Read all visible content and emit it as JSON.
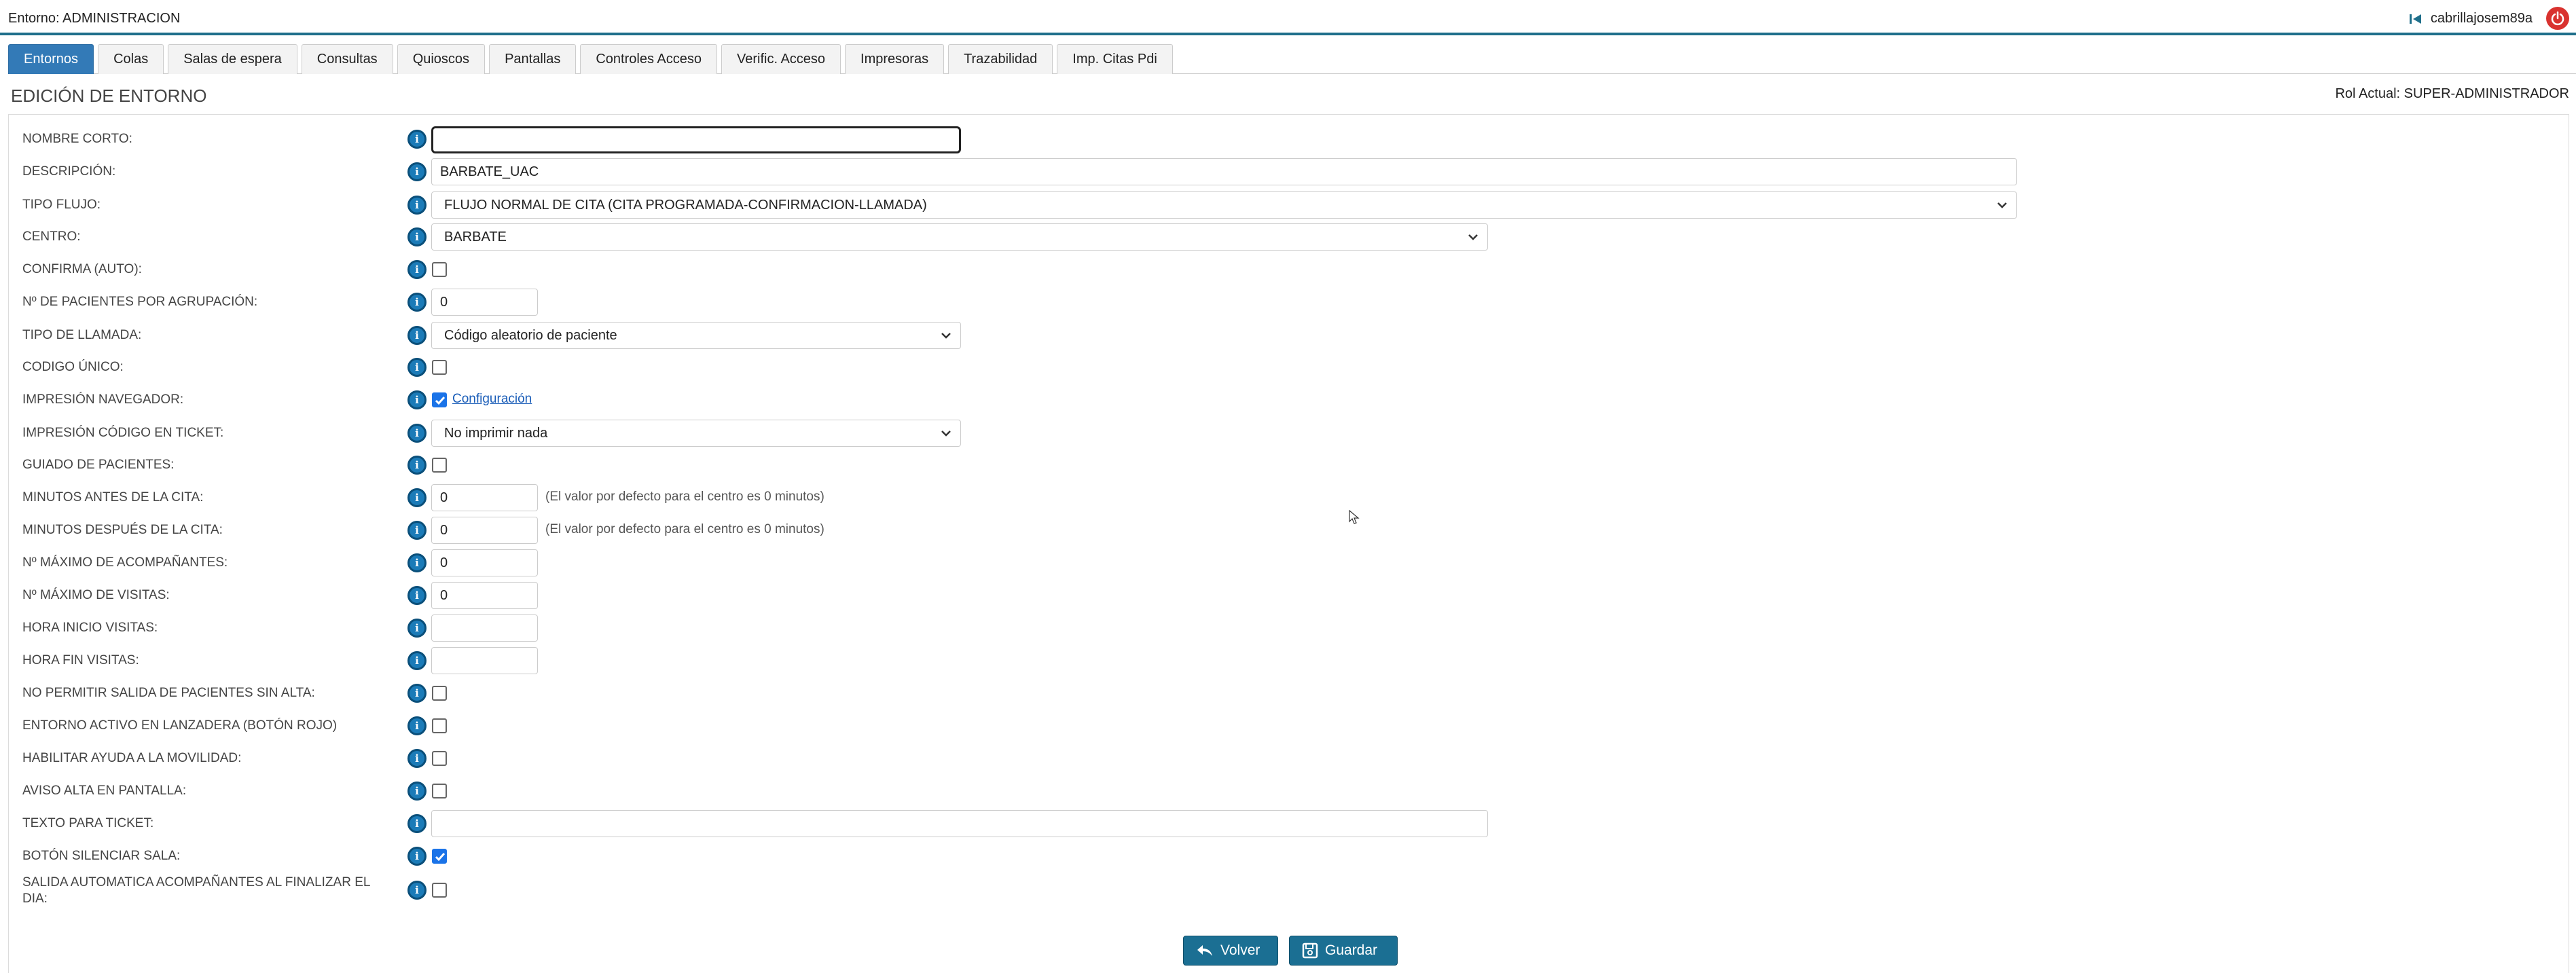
{
  "topbar": {
    "environment": "Entorno: ADMINISTRACION",
    "username": "cabrillajosem89a"
  },
  "tabs": [
    {
      "label": "Entornos",
      "active": true
    },
    {
      "label": "Colas",
      "active": false
    },
    {
      "label": "Salas de espera",
      "active": false
    },
    {
      "label": "Consultas",
      "active": false
    },
    {
      "label": "Quioscos",
      "active": false
    },
    {
      "label": "Pantallas",
      "active": false
    },
    {
      "label": "Controles Acceso",
      "active": false
    },
    {
      "label": "Verific. Acceso",
      "active": false
    },
    {
      "label": "Impresoras",
      "active": false
    },
    {
      "label": "Trazabilidad",
      "active": false
    },
    {
      "label": "Imp. Citas Pdi",
      "active": false
    }
  ],
  "section_title": "EDICIÓN DE ENTORNO",
  "role": "Rol Actual: SUPER-ADMINISTRADOR",
  "fields": {
    "nombre_corto": {
      "label": "NOMBRE CORTO:",
      "value": ""
    },
    "descripcion": {
      "label": "DESCRIPCIÓN:",
      "value": "BARBATE_UAC"
    },
    "tipo_flujo": {
      "label": "TIPO FLUJO:",
      "value": "FLUJO NORMAL DE CITA (CITA PROGRAMADA-CONFIRMACION-LLAMADA)"
    },
    "centro": {
      "label": "CENTRO:",
      "value": "BARBATE"
    },
    "confirma_auto": {
      "label": "CONFIRMA (AUTO):",
      "checked": false
    },
    "pacientes_agrupacion": {
      "label": "Nº DE PACIENTES POR AGRUPACIÓN:",
      "value": "0"
    },
    "tipo_llamada": {
      "label": "TIPO DE LLAMADA:",
      "value": "Código aleatorio de paciente"
    },
    "codigo_unico": {
      "label": "CODIGO ÚNICO:",
      "checked": false
    },
    "impresion_navegador": {
      "label": "IMPRESIÓN NAVEGADOR:",
      "checked": true,
      "link": "Configuración"
    },
    "impresion_codigo_ticket": {
      "label": "IMPRESIÓN CÓDIGO EN TICKET:",
      "value": "No imprimir nada"
    },
    "guiado_pacientes": {
      "label": "GUIADO DE PACIENTES:",
      "checked": false
    },
    "minutos_antes": {
      "label": "MINUTOS ANTES DE LA CITA:",
      "value": "0",
      "hint": "(El valor por defecto para el centro es 0 minutos)"
    },
    "minutos_despues": {
      "label": "MINUTOS DESPUÉS DE LA CITA:",
      "value": "0",
      "hint": "(El valor por defecto para el centro es 0 minutos)"
    },
    "max_acompanantes": {
      "label": "Nº MÁXIMO DE ACOMPAÑANTES:",
      "value": "0"
    },
    "max_visitas": {
      "label": "Nº MÁXIMO DE VISITAS:",
      "value": "0"
    },
    "hora_inicio_visitas": {
      "label": "HORA INICIO VISITAS:",
      "value": ""
    },
    "hora_fin_visitas": {
      "label": "HORA FIN VISITAS:",
      "value": ""
    },
    "no_permitir_salida": {
      "label": "NO PERMITIR SALIDA DE PACIENTES SIN ALTA:",
      "checked": false
    },
    "entorno_activo_lanzadera": {
      "label": "ENTORNO ACTIVO EN LANZADERA (BOTÓN ROJO)",
      "checked": false
    },
    "ayuda_movilidad": {
      "label": "HABILITAR AYUDA A LA MOVILIDAD:",
      "checked": false
    },
    "aviso_alta": {
      "label": "AVISO ALTA EN PANTALLA:",
      "checked": false
    },
    "texto_ticket": {
      "label": "TEXTO PARA TICKET:",
      "value": ""
    },
    "boton_silenciar": {
      "label": "BOTÓN SILENCIAR SALA:",
      "checked": true
    },
    "salida_automatica": {
      "label_line1": "SALIDA AUTOMATICA ACOMPAÑANTES AL FINALIZAR EL",
      "label_line2": "DIA:",
      "checked": false
    }
  },
  "info_icon_glyph": "i",
  "buttons": {
    "volver": "Volver",
    "guardar": "Guardar"
  },
  "colors": {
    "accent": "#337ab7",
    "button": "#1b6f93",
    "topbar_border": "#1f6f8b",
    "power": "#d9322f"
  }
}
